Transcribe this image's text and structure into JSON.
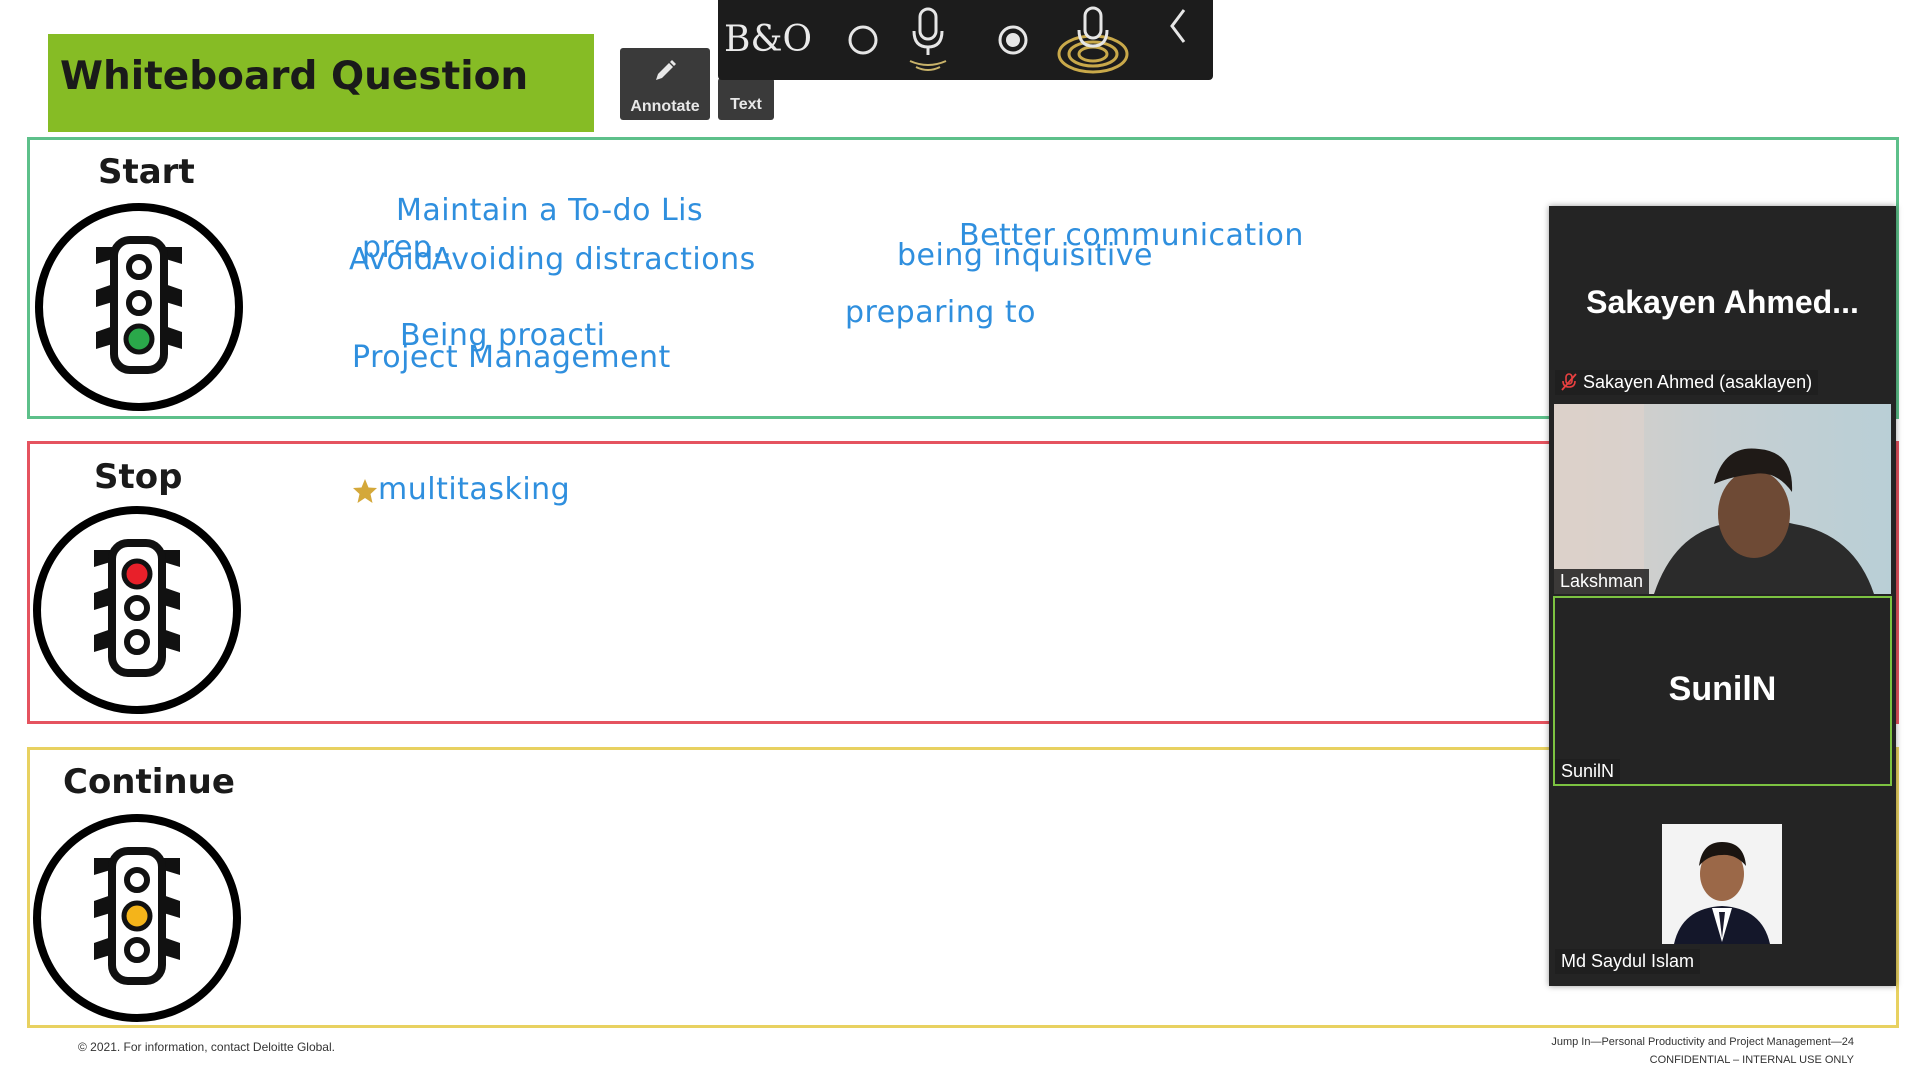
{
  "slide": {
    "title": "Whiteboard Question",
    "sections": {
      "start": {
        "label": "Start",
        "color": "#5dc08a",
        "light_color": "#2aa84a"
      },
      "stop": {
        "label": "Stop",
        "color": "#e5535f",
        "light_color": "#e8202a"
      },
      "continue": {
        "label": "Continue",
        "color": "#e8d160",
        "light_color": "#f4b41a"
      }
    },
    "notes": {
      "todo": "Maintain a To-do Lis",
      "prep": "prep..",
      "avoid": "Avoid",
      "avoiding": "Avoiding distractions",
      "better_comm": "Better communication",
      "inquisitive": "being inquisitive",
      "preparing": "preparing to",
      "proacti": "Being proacti",
      "pm": "Project Management",
      "multitasking": "multitasking"
    },
    "footer_left": "© 2021. For information, contact Deloitte Global.",
    "footer_right_line1": "Jump In—Personal Productivity and Project Management—24",
    "footer_right_line2": "CONFIDENTIAL – INTERNAL USE ONLY"
  },
  "annotation_toolbar": {
    "annotate_label": "Annotate",
    "text_label": "Text",
    "icons": [
      "pencil-icon",
      "text-icon"
    ]
  },
  "meeting_toolbar": {
    "logo_text": "B&O",
    "icons": [
      "bo-logo-icon",
      "circle-icon",
      "microphone-icon",
      "record-icon",
      "voice-active-icon",
      "collapse-chevron-icon"
    ]
  },
  "participants": {
    "active_speaker_display": "Sakayen  Ahmed...",
    "active_speaker_tag": "Sakayen Ahmed (asaklayen)",
    "video_name": "Lakshman",
    "sunil_center": "SunilN",
    "sunil_tag": "SunilN",
    "saydul_tag": "Md Saydul Islam"
  }
}
